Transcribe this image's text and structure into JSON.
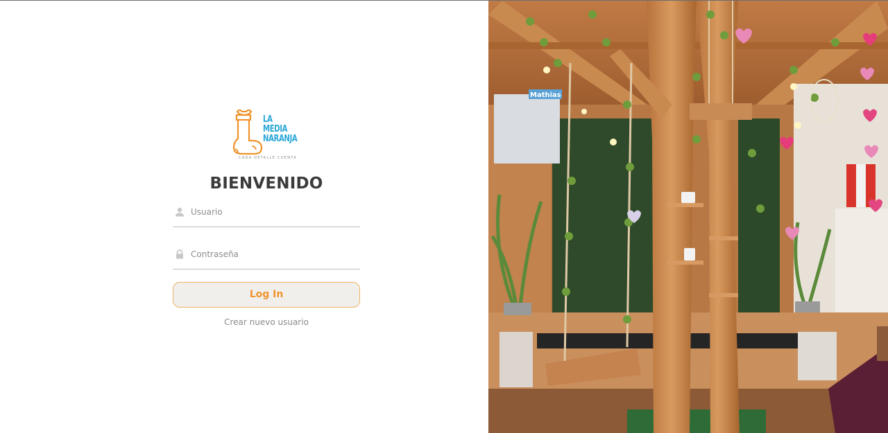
{
  "logo": {
    "line1": "LA",
    "line2": "MEDIA",
    "line3": "NARANJA",
    "tagline": "CADA DETALLE CUENTA",
    "colors": {
      "orange": "#f0932b",
      "blue": "#2aa7d8"
    }
  },
  "login": {
    "title": "BIENVENIDO",
    "username_placeholder": "Usuario",
    "password_placeholder": "Contraseña",
    "username_icon": "user-icon",
    "password_icon": "lock-icon",
    "login_button": "Log In",
    "create_user_link": "Crear nuevo usuario"
  },
  "photo": {
    "sign_text": "Mathias"
  },
  "colors": {
    "accent": "#f0932b",
    "button_bg": "#f1efec",
    "title": "#3b3b3b"
  }
}
